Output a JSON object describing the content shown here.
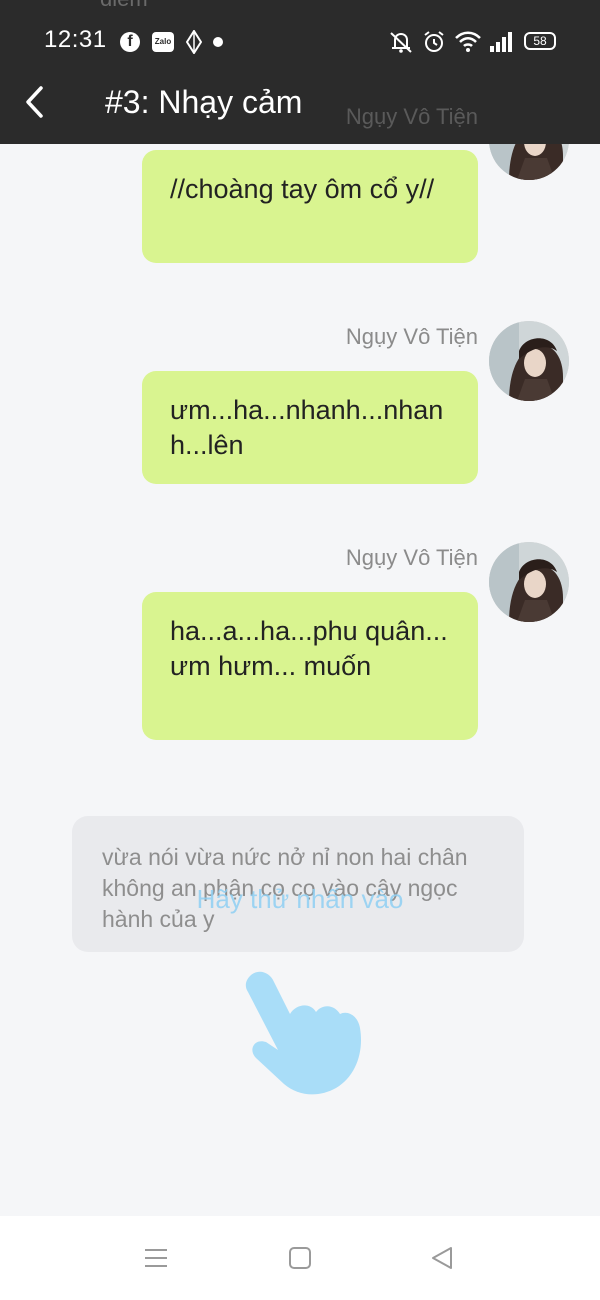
{
  "header": {
    "peek_text": "diễm",
    "title": "#3: Nhạy cảm",
    "overlap_name": "Ngụy Vô Tiện"
  },
  "status_bar": {
    "time": "12:31",
    "battery": "58",
    "icons": [
      "facebook-icon",
      "zalo-icon",
      "navigation-icon",
      "dot-icon",
      "mute-icon",
      "alarm-icon",
      "wifi-icon",
      "signal-icon",
      "battery-icon"
    ]
  },
  "messages": [
    {
      "sender": "",
      "text": "//choàng tay ôm cổ y//"
    },
    {
      "sender": "Ngụy Vô Tiện",
      "text": "ưm...ha...nhanh...nhanh...lên"
    },
    {
      "sender": "Ngụy Vô Tiện",
      "text": "ha...a...ha...phu quân... ưm hưm... muốn"
    }
  ],
  "narration": {
    "text": "vừa nói vừa nức nở nỉ non hai chân không an phận cọ cọ vào cây ngọc hành của y"
  },
  "hint": {
    "text": "Hãy thử nhấn vào",
    "icon": "pointing-hand-icon"
  },
  "colors": {
    "header_bg": "#2b2b2b",
    "bubble_bg": "#d9f490",
    "narration_bg": "#e9eaed",
    "hint_color": "#8fd0f3",
    "page_bg": "#f5f6f8"
  },
  "nav_bar": {
    "icons": [
      "menu-icon",
      "home-icon",
      "back-triangle-icon"
    ]
  }
}
